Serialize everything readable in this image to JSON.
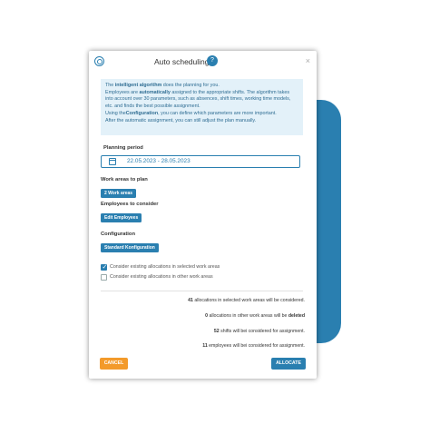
{
  "dialog": {
    "title": "Auto scheduling",
    "help_icon": "help-icon",
    "close_icon": "close-icon",
    "close_glyph": "×",
    "help_glyph": "?"
  },
  "info": {
    "l1_pre": "The ",
    "l1_bold": "intelligent algorithm",
    "l1_post": " does the planning for you.",
    "l2_pre": "Employees are ",
    "l2_bold": "automatically",
    "l2_post": " assigned to the appropriate shifts. The algorithm takes into account over 30 parameters, such as absences, shift times, working time models, etc. and finds the best possible assignment.",
    "l3_pre": "Using the",
    "l3_bold": "Configuration",
    "l3_post": ", you can define which parameters are more important.",
    "l4": "After the automatic assignment, you can still adjust the plan manually."
  },
  "planning": {
    "label": "Planning period",
    "date_range": "22.05.2023 - 28.05.2023"
  },
  "work_areas": {
    "label": "Work areas to plan",
    "chip": "2 Work areas"
  },
  "employees": {
    "label": "Employees to consider",
    "chip": "Edit Employees"
  },
  "configuration": {
    "label": "Configuration",
    "chip": "Standard Konfiguration"
  },
  "options": [
    {
      "label": "Consider existing allocations in selected work areas",
      "checked": true
    },
    {
      "label": "Consider existing allocations in other work areas",
      "checked": false
    }
  ],
  "summary": {
    "s1_num": "41",
    "s1_text": " allocations in selected work areas will be considered.",
    "s2_num": "0",
    "s2_text": " allocations in other work areas will be ",
    "s2_bold": "deleted",
    "s3_num": "52",
    "s3_text": " shifts will bei considered for assignment.",
    "s4_num": "11",
    "s4_text": " employees will bei considered for assignment."
  },
  "buttons": {
    "cancel": "CANCEL",
    "allocate": "ALLOCATE"
  },
  "colors": {
    "accent": "#2a7fb0",
    "cancel": "#f39a2b",
    "info_bg": "#e3f1f9"
  }
}
